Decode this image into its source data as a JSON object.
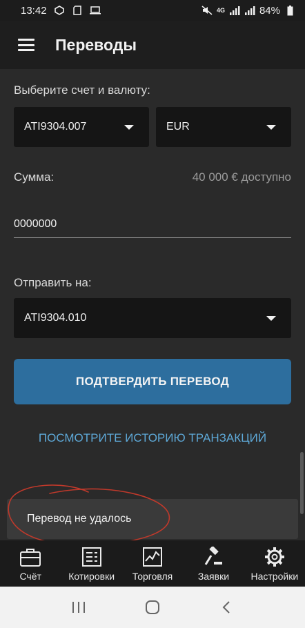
{
  "status_bar": {
    "time": "13:42",
    "network": "4G",
    "battery": "84%"
  },
  "app_bar": {
    "title": "Переводы",
    "menu_icon": "menu-icon"
  },
  "form": {
    "account_label": "Выберите счет и валюту:",
    "account_value": "ATI9304.007",
    "currency_value": "EUR",
    "amount_label": "Сумма:",
    "available_text": "40 000 € доступно",
    "amount_value": "0000000",
    "send_to_label": "Отправить на:",
    "send_to_value": "ATI9304.010",
    "confirm_button": "ПОДТВЕРДИТЬ ПЕРЕВОД",
    "history_link": "ПОСМОТРИТЕ ИСТОРИЮ ТРАНЗАКЦИЙ"
  },
  "toast": {
    "message": "Перевод не удалось"
  },
  "bottom_nav": {
    "items": [
      {
        "label": "Счёт",
        "icon": "briefcase-icon"
      },
      {
        "label": "Котировки",
        "icon": "quotes-list-icon"
      },
      {
        "label": "Торговля",
        "icon": "chart-icon"
      },
      {
        "label": "Заявки",
        "icon": "gavel-icon"
      },
      {
        "label": "Настройки",
        "icon": "gear-icon"
      }
    ]
  },
  "colors": {
    "accent_button": "#2d6e9e",
    "link": "#5ea9d8",
    "annotation": "#c0392b"
  }
}
